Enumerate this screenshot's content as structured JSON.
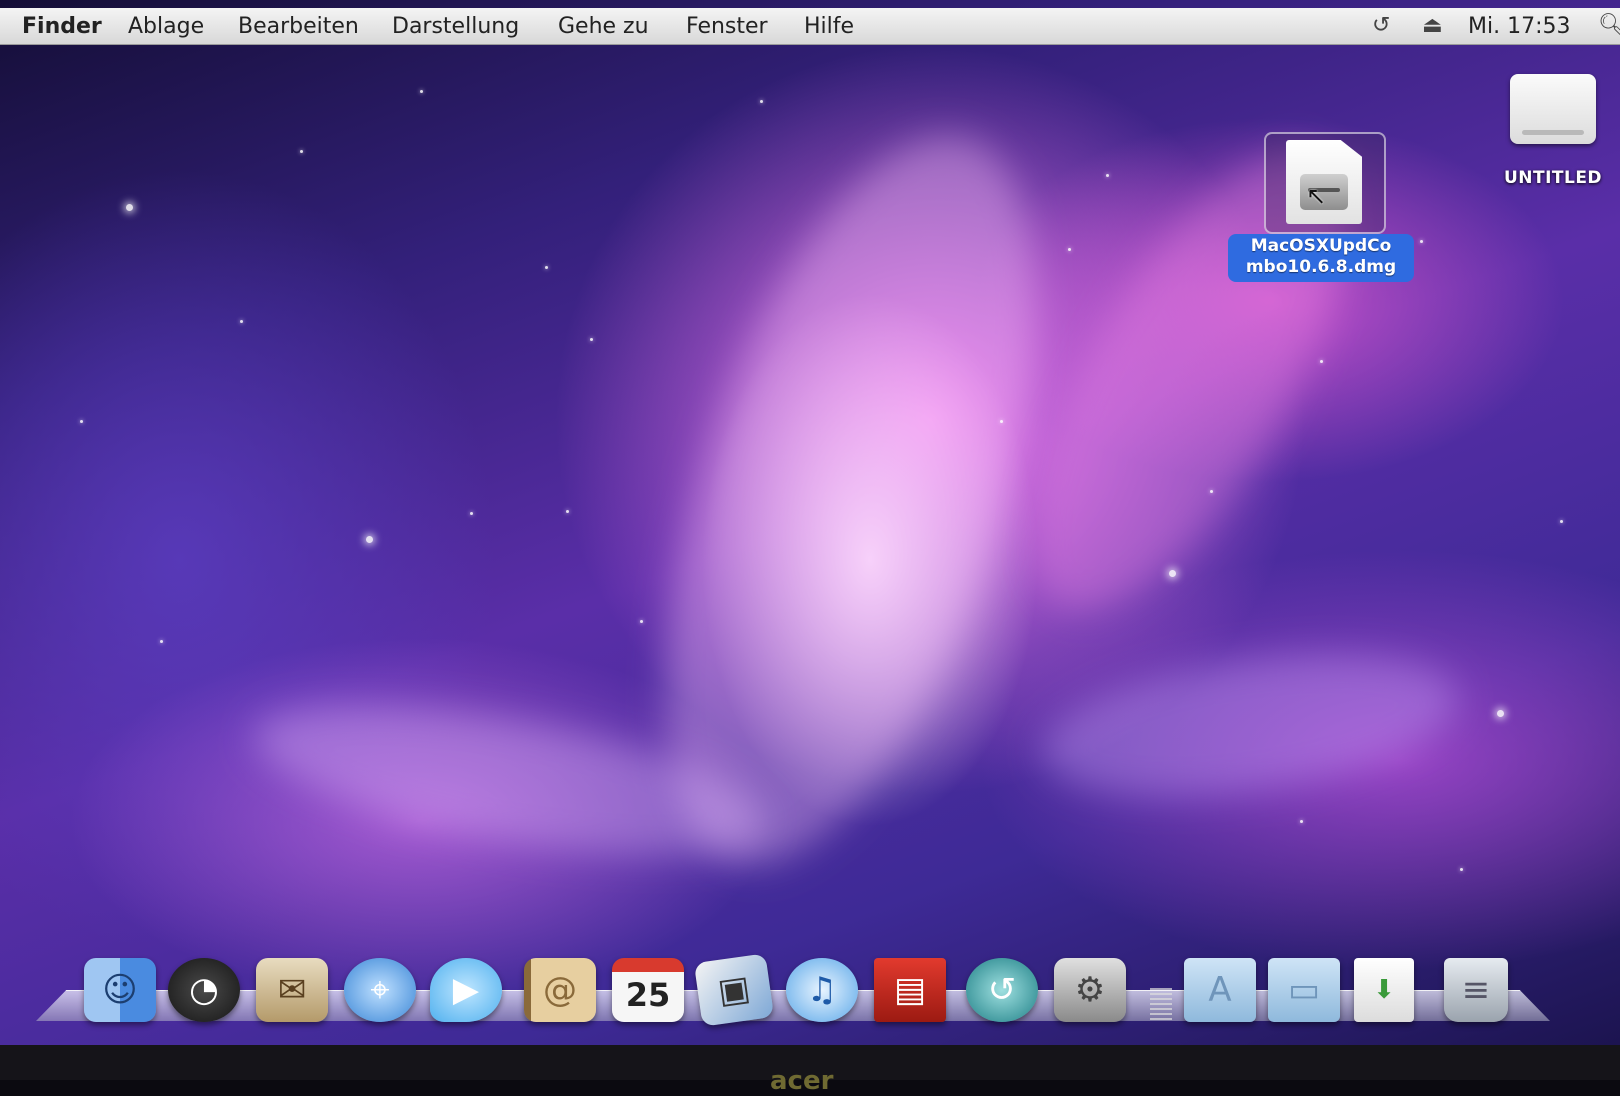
{
  "menubar": {
    "app": "Finder",
    "items": [
      "Ablage",
      "Bearbeiten",
      "Darstellung",
      "Gehe zu",
      "Fenster",
      "Hilfe"
    ],
    "clock": "Mi. 17:53",
    "status_icons": [
      "time-machine-icon",
      "eject-icon",
      "spotlight-icon"
    ]
  },
  "desktop": {
    "icons": [
      {
        "label": "UNTITLED",
        "icon": "drive-icon"
      },
      {
        "label": "MacOSXUpdCombo10.6.8.dmg",
        "label_line1": "MacOSXUpdCo",
        "label_line2": "mbo10.6.8.dmg",
        "icon": "disk-image-icon",
        "selected": true
      }
    ]
  },
  "dock": {
    "calendar_day": "25",
    "items": [
      "finder-icon",
      "dashboard-icon",
      "mail-icon",
      "safari-icon",
      "ichat-icon",
      "address-book-icon",
      "ical-icon",
      "iphoto-icon",
      "itunes-icon",
      "photo-booth-icon",
      "time-machine-icon",
      "system-preferences-icon",
      "applications-folder-icon",
      "documents-folder-icon",
      "downloads-stack-icon",
      "trash-icon"
    ],
    "colors": {
      "finder": "#4a8be0",
      "dashboard": "#2b2b2b",
      "mail": "#c7b48a",
      "safari": "#3a86d6",
      "ichat": "#4fb0ee",
      "address_book": "#c9a36a",
      "ical": "#f2f2f2",
      "iphoto": "#7ea8d6",
      "itunes": "#5aa7e8",
      "photo_booth": "#d32a20",
      "time_machine": "#1e7f86",
      "system_preferences": "#9a9a9a",
      "folder": "#8fb9dc",
      "trash": "#b9c0c8"
    }
  },
  "monitor": {
    "brand": "acer"
  },
  "selection_color": "#2f6be0"
}
